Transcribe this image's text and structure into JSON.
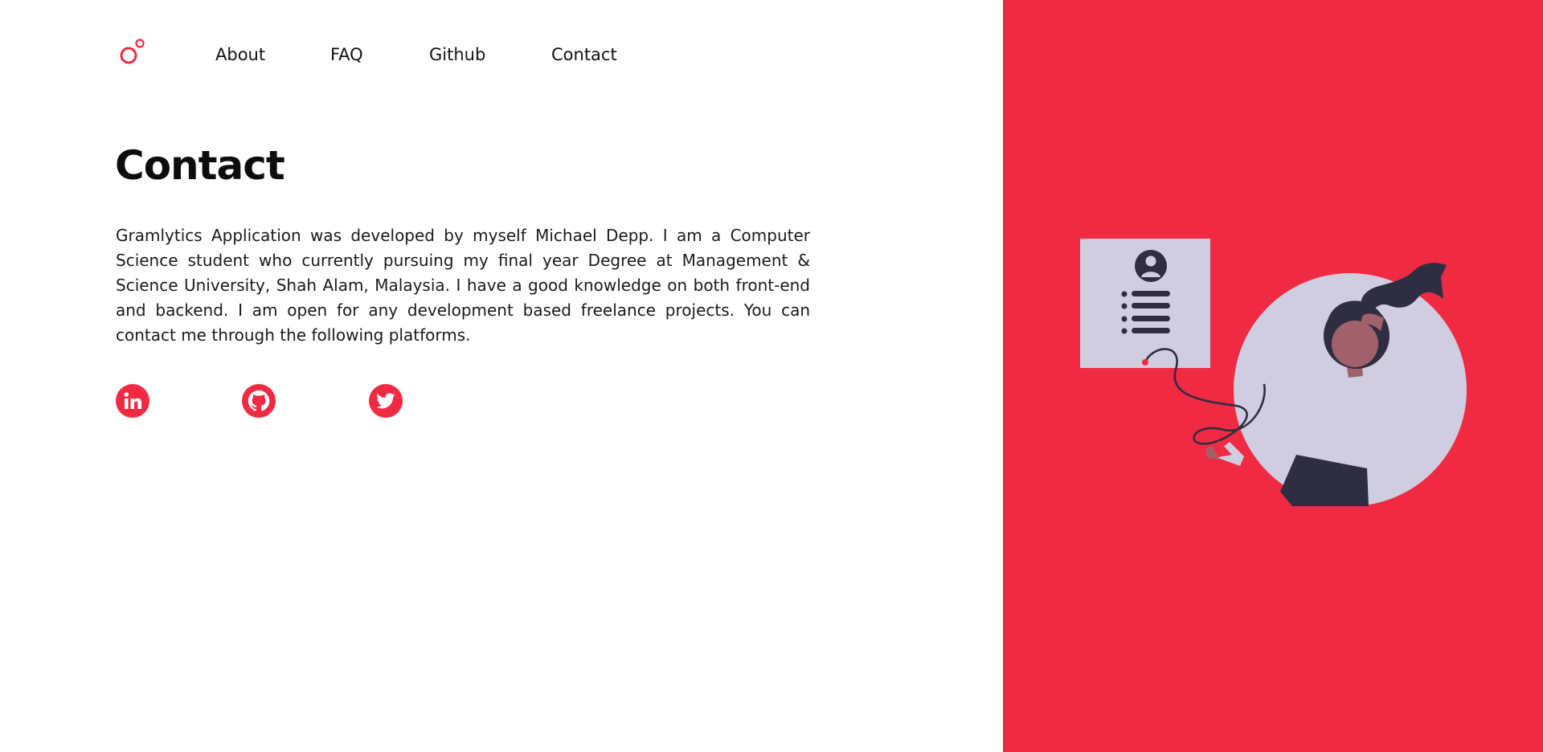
{
  "nav": {
    "logo_icon": "circles-logo-icon",
    "items": [
      {
        "label": "About"
      },
      {
        "label": "FAQ"
      },
      {
        "label": "Github"
      },
      {
        "label": "Contact"
      }
    ]
  },
  "main": {
    "title": "Contact",
    "description": "Gramlytics Application was developed by myself Michael Depp. I am a Computer Science student who currently pursuing my final year Degree at Management & Science University, Shah Alam, Malaysia. I have a good knowledge on both front-end and backend. I am open for any development based freelance projects. You can contact me through the following platforms."
  },
  "social": [
    {
      "icon": "linkedin-icon"
    },
    {
      "icon": "github-icon"
    },
    {
      "icon": "twitter-icon"
    }
  ],
  "colors": {
    "accent": "#f02a43",
    "illustration_light": "#d0cde1",
    "illustration_dark": "#2f2e41",
    "skin": "#a0616a"
  }
}
